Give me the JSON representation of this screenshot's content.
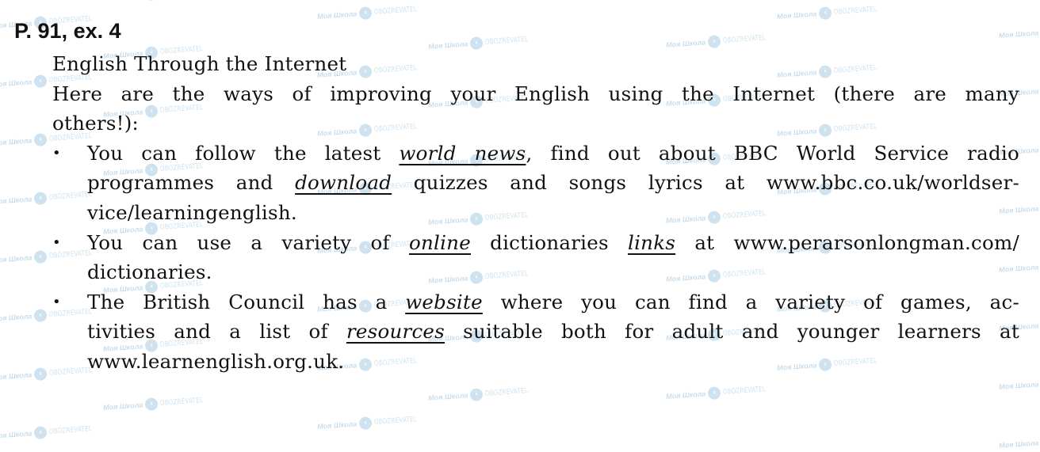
{
  "page": {
    "heading": "P. 91, ex. 4",
    "title": "English Through the Internet",
    "intro": {
      "line1": "Here are the ways of improving your English using the Internet (there are many",
      "line2": "others!):"
    },
    "bullet_glyph": "•",
    "bullets": [
      {
        "line1": {
          "a": "You can follow the latest ",
          "kw1": "world news",
          "b": ", find out about BBC World Service radio"
        },
        "line2": {
          "a": "programmes and ",
          "kw1": "download",
          "b": " quizzes and songs lyrics at www.bbc.co.uk/worldser-"
        },
        "line3": {
          "a": "vice/learningenglish."
        }
      },
      {
        "line1": {
          "a": "You can use a variety of ",
          "kw1": "online",
          "b": " dictionaries ",
          "kw2": "links",
          "c": " at www.perarsonlongman.com/"
        },
        "line2": {
          "a": "dictionaries."
        }
      },
      {
        "line1": {
          "a": "The British Council has a ",
          "kw1": "website",
          "b": " where you can find a variety of games, ac-"
        },
        "line2": {
          "a": "tivities and a list of ",
          "kw1": "resources",
          "b": " suitable both for adult and younger learners at"
        },
        "line3": {
          "a": "www.learnenglish.org.uk."
        }
      }
    ]
  },
  "watermark": {
    "school_label": "Моя Школа",
    "brand_label": "OBOZREVATEL",
    "icon": "obozrevatel-logo-icon",
    "color": "#a9cbe2"
  }
}
